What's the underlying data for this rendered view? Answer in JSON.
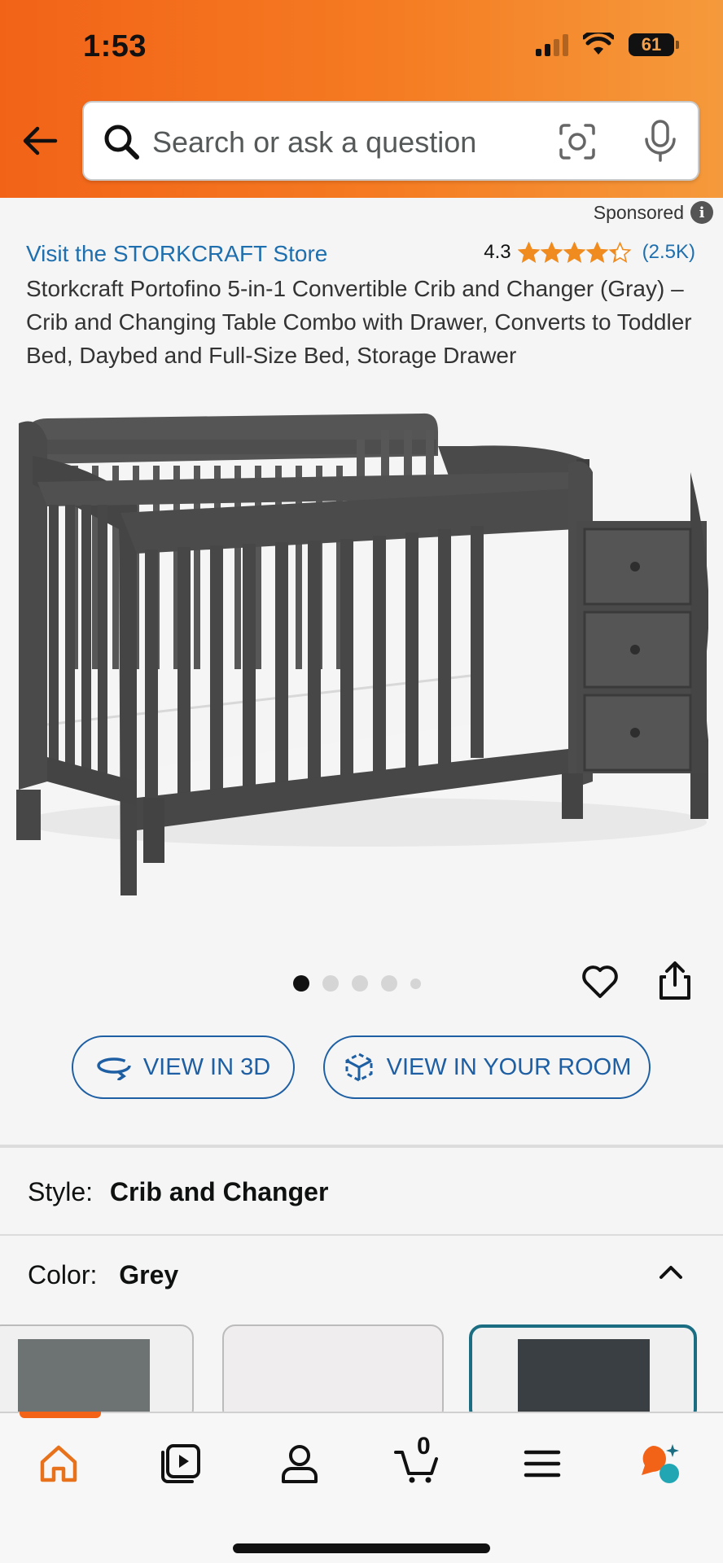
{
  "status_bar": {
    "time": "1:53",
    "battery": "61"
  },
  "search": {
    "placeholder": "Search or ask a question"
  },
  "sponsored_label": "Sponsored",
  "product": {
    "store_link": "Visit the STORKCRAFT Store",
    "rating": "4.3",
    "stars": 4.3,
    "rating_count": "(2.5K)",
    "title": "Storkcraft Portofino 5-in-1 Convertible Crib and Changer (Gray) – Crib and Changing Table Combo with Drawer, Converts to Toddler Bed, Daybed and Full-Size Bed, Storage Drawer",
    "image_count": 5,
    "active_image": 1
  },
  "buttons": {
    "view_3d": "VIEW IN 3D",
    "view_room": "VIEW IN YOUR ROOM"
  },
  "variations": {
    "style_label": "Style:",
    "style_value": "Crib and Changer",
    "color_label": "Color:",
    "color_value": "Grey",
    "swatches": [
      {
        "color": "#6d7272",
        "selected": false
      },
      {
        "color": "#efeded",
        "selected": false
      },
      {
        "color": "#3a3f44",
        "selected": true
      }
    ]
  },
  "bottom_nav": {
    "items": [
      "home-icon",
      "video-icon",
      "account-icon",
      "cart-icon",
      "menu-icon",
      "rufus-icon"
    ],
    "cart_count": "0"
  },
  "colors": {
    "header_start": "#f26318",
    "header_end": "#f59a3c",
    "link_blue": "#1f6fae",
    "star_orange": "#f08b1f",
    "crib_gray": "#4a4a4a"
  }
}
